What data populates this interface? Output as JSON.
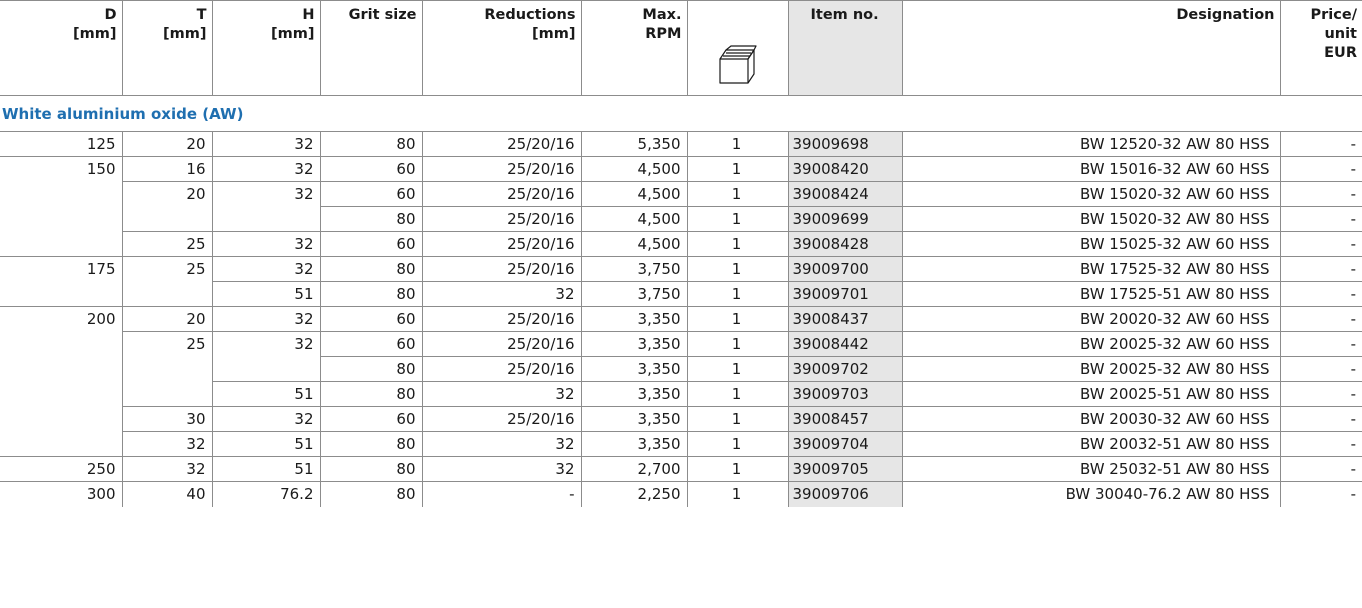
{
  "headers": {
    "d": "D\n[mm]",
    "t": "T\n[mm]",
    "h": "H\n[mm]",
    "grit": "Grit size",
    "reductions": "Reductions\n[mm]",
    "rpm": "Max.\nRPM",
    "pack_icon": "box-icon",
    "item": "Item no.",
    "designation": "Designation",
    "price": "Price/\nunit\nEUR"
  },
  "section_title": "White aluminium oxide (AW)",
  "colors": {
    "section_title": "#1f6fb0",
    "item_column_bg": "#e6e6e6",
    "border": "#8c8c8c"
  },
  "rows": [
    {
      "d": "125",
      "t": "20",
      "h": "32",
      "grit": "80",
      "red": "25/20/16",
      "rpm": "5,350",
      "pack": "1",
      "item": "39009698",
      "des": "BW 12520-32 AW 80 HSS",
      "price": "-"
    },
    {
      "d": "150",
      "t": "16",
      "h": "32",
      "grit": "60",
      "red": "25/20/16",
      "rpm": "4,500",
      "pack": "1",
      "item": "39008420",
      "des": "BW 15016-32 AW 60 HSS",
      "price": "-"
    },
    {
      "d": "",
      "t": "20",
      "h": "32",
      "grit": "60",
      "red": "25/20/16",
      "rpm": "4,500",
      "pack": "1",
      "item": "39008424",
      "des": "BW 15020-32 AW 60 HSS",
      "price": "-"
    },
    {
      "d": "",
      "t": "",
      "h": "",
      "grit": "80",
      "red": "25/20/16",
      "rpm": "4,500",
      "pack": "1",
      "item": "39009699",
      "des": "BW 15020-32 AW 80 HSS",
      "price": "-"
    },
    {
      "d": "",
      "t": "25",
      "h": "32",
      "grit": "60",
      "red": "25/20/16",
      "rpm": "4,500",
      "pack": "1",
      "item": "39008428",
      "des": "BW 15025-32 AW 60 HSS",
      "price": "-"
    },
    {
      "d": "175",
      "t": "25",
      "h": "32",
      "grit": "80",
      "red": "25/20/16",
      "rpm": "3,750",
      "pack": "1",
      "item": "39009700",
      "des": "BW 17525-32 AW 80 HSS",
      "price": "-"
    },
    {
      "d": "",
      "t": "",
      "h": "51",
      "grit": "80",
      "red": "32",
      "rpm": "3,750",
      "pack": "1",
      "item": "39009701",
      "des": "BW 17525-51 AW 80 HSS",
      "price": "-"
    },
    {
      "d": "200",
      "t": "20",
      "h": "32",
      "grit": "60",
      "red": "25/20/16",
      "rpm": "3,350",
      "pack": "1",
      "item": "39008437",
      "des": "BW 20020-32 AW 60 HSS",
      "price": "-"
    },
    {
      "d": "",
      "t": "25",
      "h": "32",
      "grit": "60",
      "red": "25/20/16",
      "rpm": "3,350",
      "pack": "1",
      "item": "39008442",
      "des": "BW 20025-32 AW 60 HSS",
      "price": "-"
    },
    {
      "d": "",
      "t": "",
      "h": "",
      "grit": "80",
      "red": "25/20/16",
      "rpm": "3,350",
      "pack": "1",
      "item": "39009702",
      "des": "BW 20025-32 AW 80 HSS",
      "price": "-"
    },
    {
      "d": "",
      "t": "",
      "h": "51",
      "grit": "80",
      "red": "32",
      "rpm": "3,350",
      "pack": "1",
      "item": "39009703",
      "des": "BW 20025-51 AW 80 HSS",
      "price": "-"
    },
    {
      "d": "",
      "t": "30",
      "h": "32",
      "grit": "60",
      "red": "25/20/16",
      "rpm": "3,350",
      "pack": "1",
      "item": "39008457",
      "des": "BW 20030-32 AW 60 HSS",
      "price": "-"
    },
    {
      "d": "",
      "t": "32",
      "h": "51",
      "grit": "80",
      "red": "32",
      "rpm": "3,350",
      "pack": "1",
      "item": "39009704",
      "des": "BW 20032-51 AW 80 HSS",
      "price": "-"
    },
    {
      "d": "250",
      "t": "32",
      "h": "51",
      "grit": "80",
      "red": "32",
      "rpm": "2,700",
      "pack": "1",
      "item": "39009705",
      "des": "BW 25032-51 AW 80 HSS",
      "price": "-"
    },
    {
      "d": "300",
      "t": "40",
      "h": "76.2",
      "grit": "80",
      "red": "-",
      "rpm": "2,250",
      "pack": "1",
      "item": "39009706",
      "des": "BW 30040-76.2 AW 80 HSS",
      "price": "-"
    }
  ]
}
